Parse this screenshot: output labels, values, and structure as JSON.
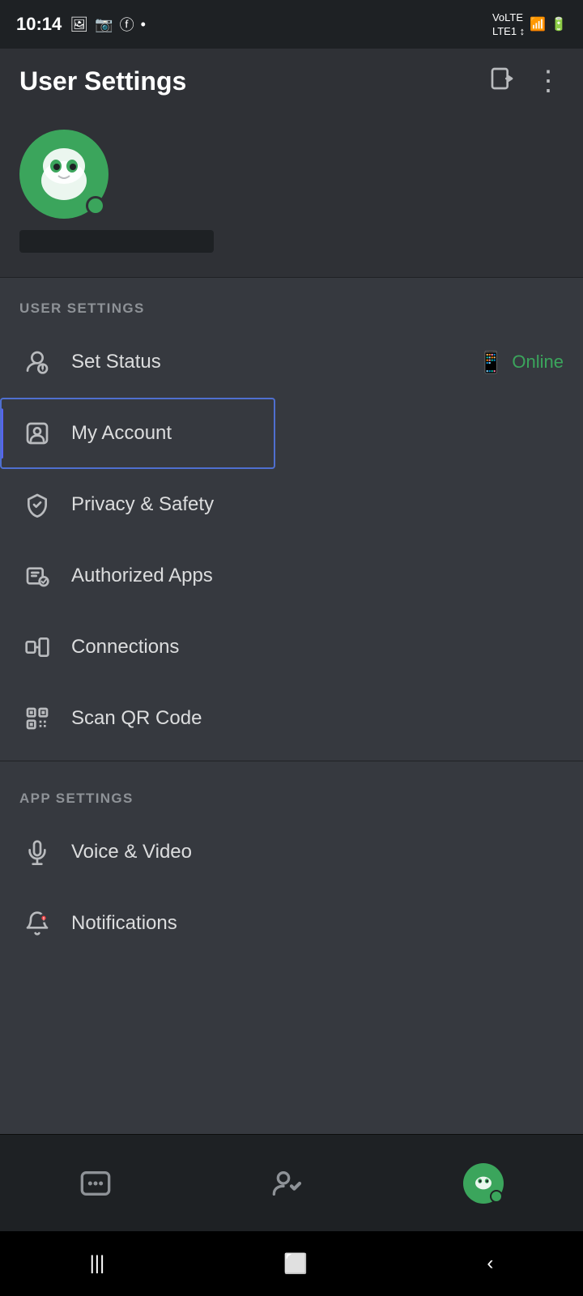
{
  "statusBar": {
    "time": "10:14",
    "carrier": "VoLTE 4G",
    "dot": "•"
  },
  "header": {
    "title": "User Settings",
    "logout_icon": "⊕",
    "more_icon": "⋮"
  },
  "profile": {
    "username_redacted": true
  },
  "userSettings": {
    "section_label": "USER SETTINGS",
    "items": [
      {
        "id": "set-status",
        "label": "Set Status",
        "status_right": "Online",
        "active": false
      },
      {
        "id": "my-account",
        "label": "My Account",
        "active": true
      },
      {
        "id": "privacy-safety",
        "label": "Privacy & Safety",
        "active": false
      },
      {
        "id": "authorized-apps",
        "label": "Authorized Apps",
        "active": false
      },
      {
        "id": "connections",
        "label": "Connections",
        "active": false
      },
      {
        "id": "scan-qr",
        "label": "Scan QR Code",
        "active": false
      }
    ]
  },
  "appSettings": {
    "section_label": "APP SETTINGS",
    "items": [
      {
        "id": "voice-video",
        "label": "Voice & Video",
        "active": false
      },
      {
        "id": "notifications",
        "label": "Notifications",
        "active": false
      }
    ]
  },
  "bottomNav": [
    {
      "id": "chat",
      "label": "Chat"
    },
    {
      "id": "friends",
      "label": "Friends"
    },
    {
      "id": "profile",
      "label": "Profile",
      "active": true
    }
  ]
}
